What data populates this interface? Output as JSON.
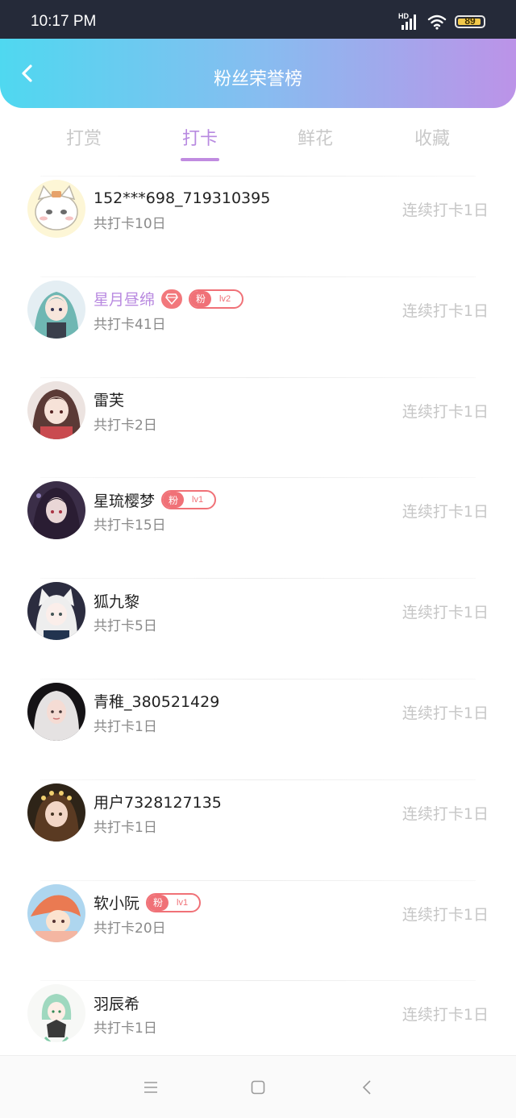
{
  "status_bar": {
    "time": "10:17 PM",
    "network": "HD",
    "battery": "89"
  },
  "header": {
    "title": "粉丝荣誉榜",
    "back_icon": "chevron-left-icon"
  },
  "tabs": [
    {
      "label": "打赏",
      "active": false
    },
    {
      "label": "打卡",
      "active": true
    },
    {
      "label": "鲜花",
      "active": false
    },
    {
      "label": "收藏",
      "active": false
    }
  ],
  "colors": {
    "accent": "#b88ae0",
    "badge": "#f07177",
    "header_start": "#4fd8f0",
    "header_end": "#bc93e8"
  },
  "fans": [
    {
      "name": "152***698_719310395",
      "total": "共打卡10日",
      "streak": "连续打卡1日",
      "vip": false,
      "fan_level": null,
      "gem": false,
      "avatar": "cartoon-cat-avatar"
    },
    {
      "name": "星月昼绵",
      "total": "共打卡41日",
      "streak": "连续打卡1日",
      "vip": true,
      "fan_label": "粉",
      "fan_level": "lv2",
      "gem": true,
      "avatar": "anime-girl-avatar"
    },
    {
      "name": "雷芙",
      "total": "共打卡2日",
      "streak": "连续打卡1日",
      "vip": false,
      "fan_level": null,
      "gem": false,
      "avatar": "anime-girl-avatar"
    },
    {
      "name": "星琉樱梦",
      "total": "共打卡15日",
      "streak": "连续打卡1日",
      "vip": false,
      "fan_label": "粉",
      "fan_level": "lv1",
      "gem": false,
      "avatar": "anime-girl-avatar"
    },
    {
      "name": "狐九黎",
      "total": "共打卡5日",
      "streak": "连续打卡1日",
      "vip": false,
      "fan_level": null,
      "gem": false,
      "avatar": "anime-fox-avatar"
    },
    {
      "name": "青稚_380521429",
      "total": "共打卡1日",
      "streak": "连续打卡1日",
      "vip": false,
      "fan_level": null,
      "gem": false,
      "avatar": "photo-avatar"
    },
    {
      "name": "用户7328127135",
      "total": "共打卡1日",
      "streak": "连续打卡1日",
      "vip": false,
      "fan_level": null,
      "gem": false,
      "avatar": "photo-avatar"
    },
    {
      "name": "软小阮",
      "total": "共打卡20日",
      "streak": "连续打卡1日",
      "vip": false,
      "fan_label": "粉",
      "fan_level": "lv1",
      "gem": false,
      "avatar": "cartoon-avatar"
    },
    {
      "name": "羽辰希",
      "total": "共打卡1日",
      "streak": "连续打卡1日",
      "vip": false,
      "fan_level": null,
      "gem": false,
      "avatar": "chibi-avatar"
    }
  ],
  "nav_bar": {
    "menu_icon": "menu-icon",
    "home_icon": "home-square-icon",
    "back_icon": "back-triangle-icon"
  }
}
